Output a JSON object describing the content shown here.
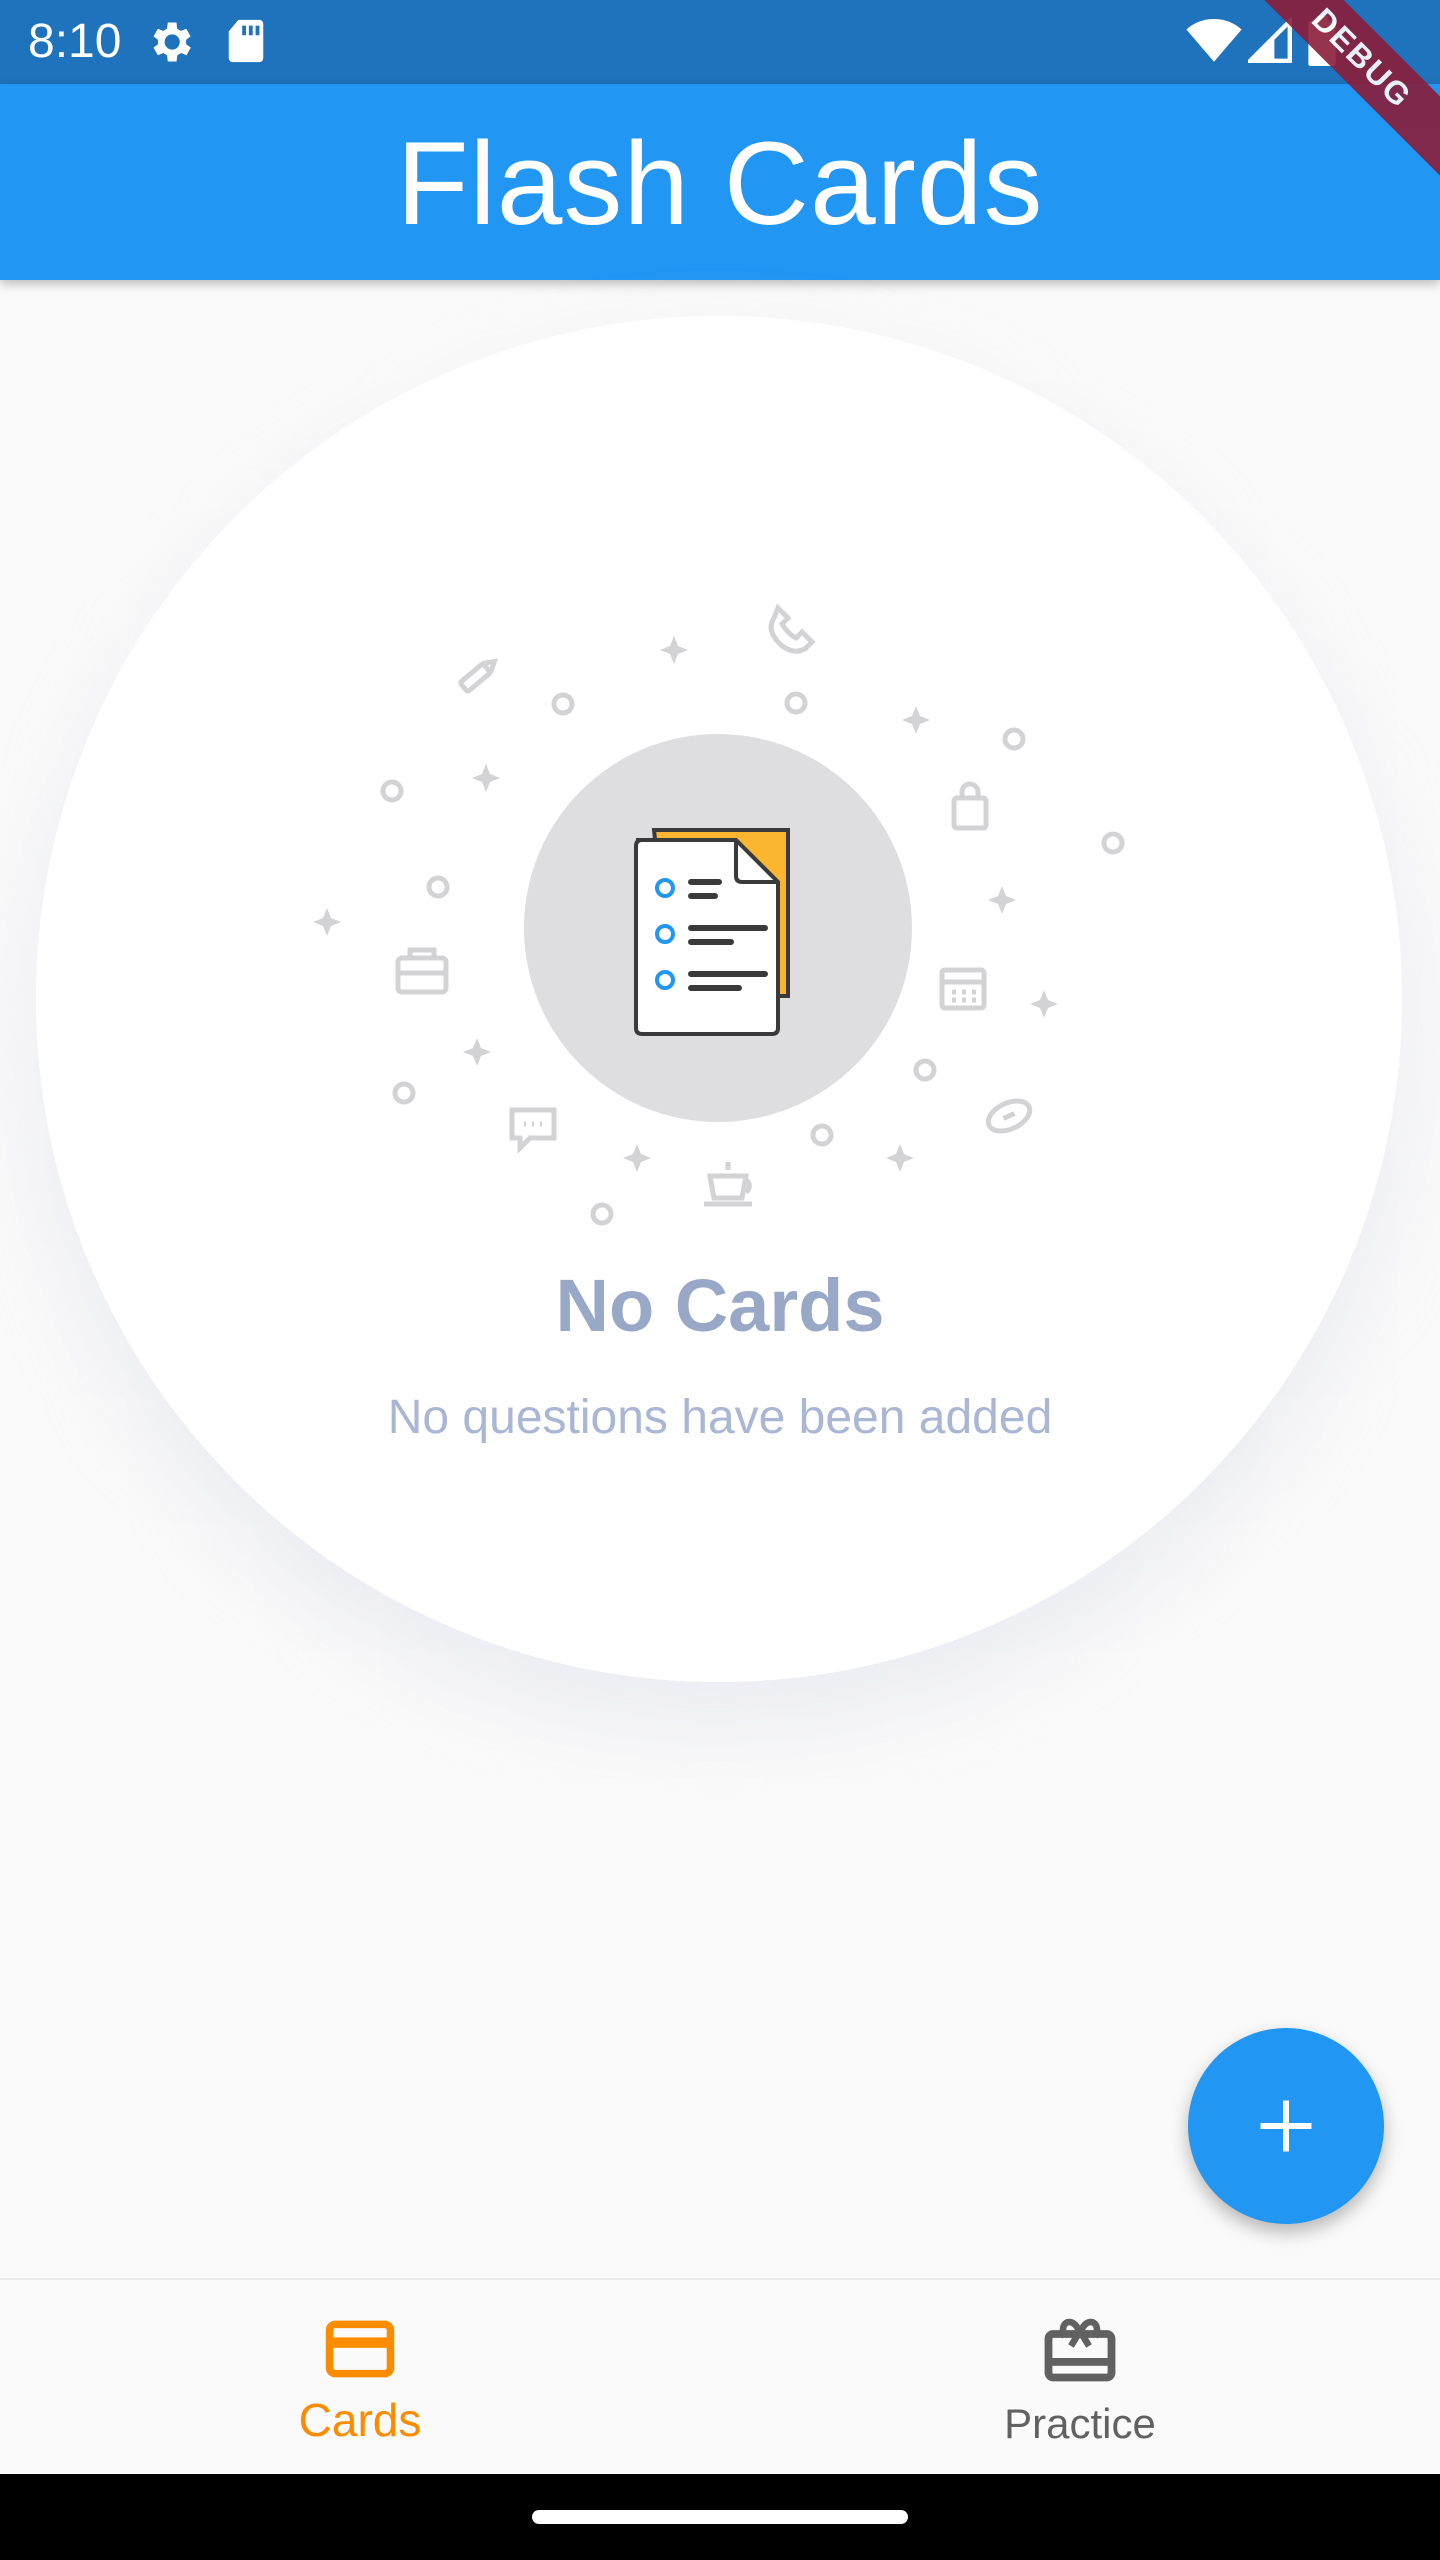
{
  "status_bar": {
    "time": "8:10",
    "icons": [
      "settings-gear-icon",
      "sd-card-icon",
      "wifi-icon",
      "signal-icon",
      "battery-icon"
    ]
  },
  "debug_banner": "DEBUG",
  "app_bar": {
    "title": "Flash Cards",
    "color": "#2196F3"
  },
  "empty_state": {
    "title": "No Cards",
    "subtitle": "No questions have been added",
    "illustration_icon": "document-list-icon"
  },
  "fab": {
    "icon": "add-icon",
    "color": "#2196F3"
  },
  "bottom_nav": {
    "items": [
      {
        "label": "Cards",
        "icon": "credit-card-icon",
        "active": true,
        "color": "#FB8C00"
      },
      {
        "label": "Practice",
        "icon": "card-giftcard-icon",
        "active": false,
        "color": "#616161"
      }
    ]
  }
}
